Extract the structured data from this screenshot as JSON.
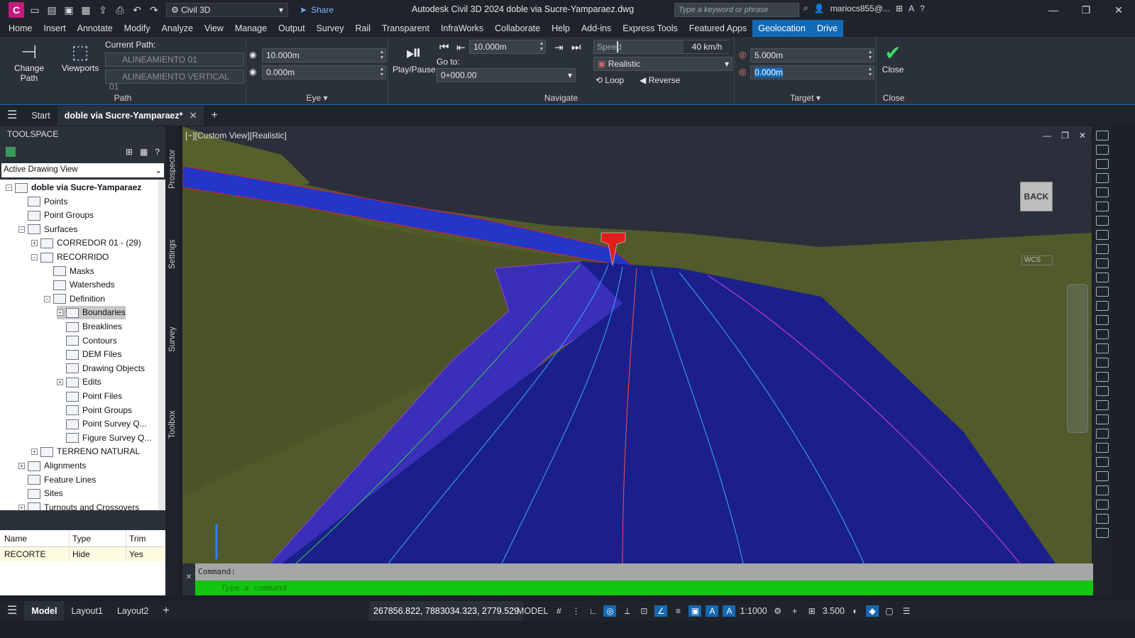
{
  "app": {
    "logo_letter": "C",
    "workspace": "Civil 3D",
    "share_label": "Share",
    "window_title": "Autodesk Civil 3D 2024    doble via Sucre-Yamparaez.dwg",
    "search_placeholder": "Type a keyword or phrase",
    "user": "mariocs855@..."
  },
  "menu": [
    "Home",
    "Insert",
    "Annotate",
    "Modify",
    "Analyze",
    "View",
    "Manage",
    "Output",
    "Survey",
    "Rail",
    "Transparent",
    "InfraWorks",
    "Collaborate",
    "Help",
    "Add-ins",
    "Express Tools",
    "Featured Apps",
    "Geolocation",
    "Drive"
  ],
  "ribbon": {
    "path": {
      "title": "Path",
      "change_path": "Change Path",
      "viewports": "Viewports",
      "current_path_label": "Current Path:",
      "alignment": "ALINEAMIENTO 01",
      "profile": "ALINEAMIENTO VERTICAL 01"
    },
    "eye": {
      "title": "Eye",
      "distance": "10.000m",
      "height": "0.000m"
    },
    "navigate": {
      "title": "Navigate",
      "play_pause": "Play/Pause",
      "step": "10.000m",
      "goto_label": "Go to:",
      "goto_value": "0+000.00",
      "speed_label": "Speed",
      "speed_value": "40 km/h",
      "visual_style": "Realistic",
      "loop": "Loop",
      "reverse": "Reverse"
    },
    "target": {
      "title": "Target",
      "distance": "5.000m",
      "height": "0.000m"
    },
    "close": {
      "title": "Close",
      "label": "Close"
    }
  },
  "tabs": {
    "start": "Start",
    "document": "doble via Sucre-Yamparaez*"
  },
  "toolspace": {
    "title": "TOOLSPACE",
    "view": "Active Drawing View",
    "tree": [
      "doble via Sucre-Yamparaez",
      "Points",
      "Point Groups",
      "Surfaces",
      "CORREDOR 01 - (29)",
      "RECORRIDO",
      "Masks",
      "Watersheds",
      "Definition",
      "Boundaries",
      "Breaklines",
      "Contours",
      "DEM Files",
      "Drawing Objects",
      "Edits",
      "Point Files",
      "Point Groups",
      "Point Survey Q...",
      "Figure Survey Q...",
      "TERRENO NATURAL",
      "Alignments",
      "Feature Lines",
      "Sites",
      "Turnouts and Crossovers"
    ],
    "vtabs": [
      "Prospector",
      "Settings",
      "Survey",
      "Toolbox"
    ],
    "grid": {
      "headers": [
        "Name",
        "Type",
        "Trim"
      ],
      "rows": [
        [
          "RECORTE",
          "Hide",
          "Yes"
        ]
      ]
    }
  },
  "viewport": {
    "label": "[−][Custom View][Realistic]",
    "viewcube": "BACK",
    "wcs": "WCS"
  },
  "command": {
    "history": "Command:",
    "placeholder": "Type a command"
  },
  "status": {
    "model": "Model",
    "layout1": "Layout1",
    "layout2": "Layout2",
    "coords": "267856.822, 7883034.323, 2779.529",
    "space": "MODEL",
    "scale": "1:1000",
    "annot": "3.500"
  }
}
